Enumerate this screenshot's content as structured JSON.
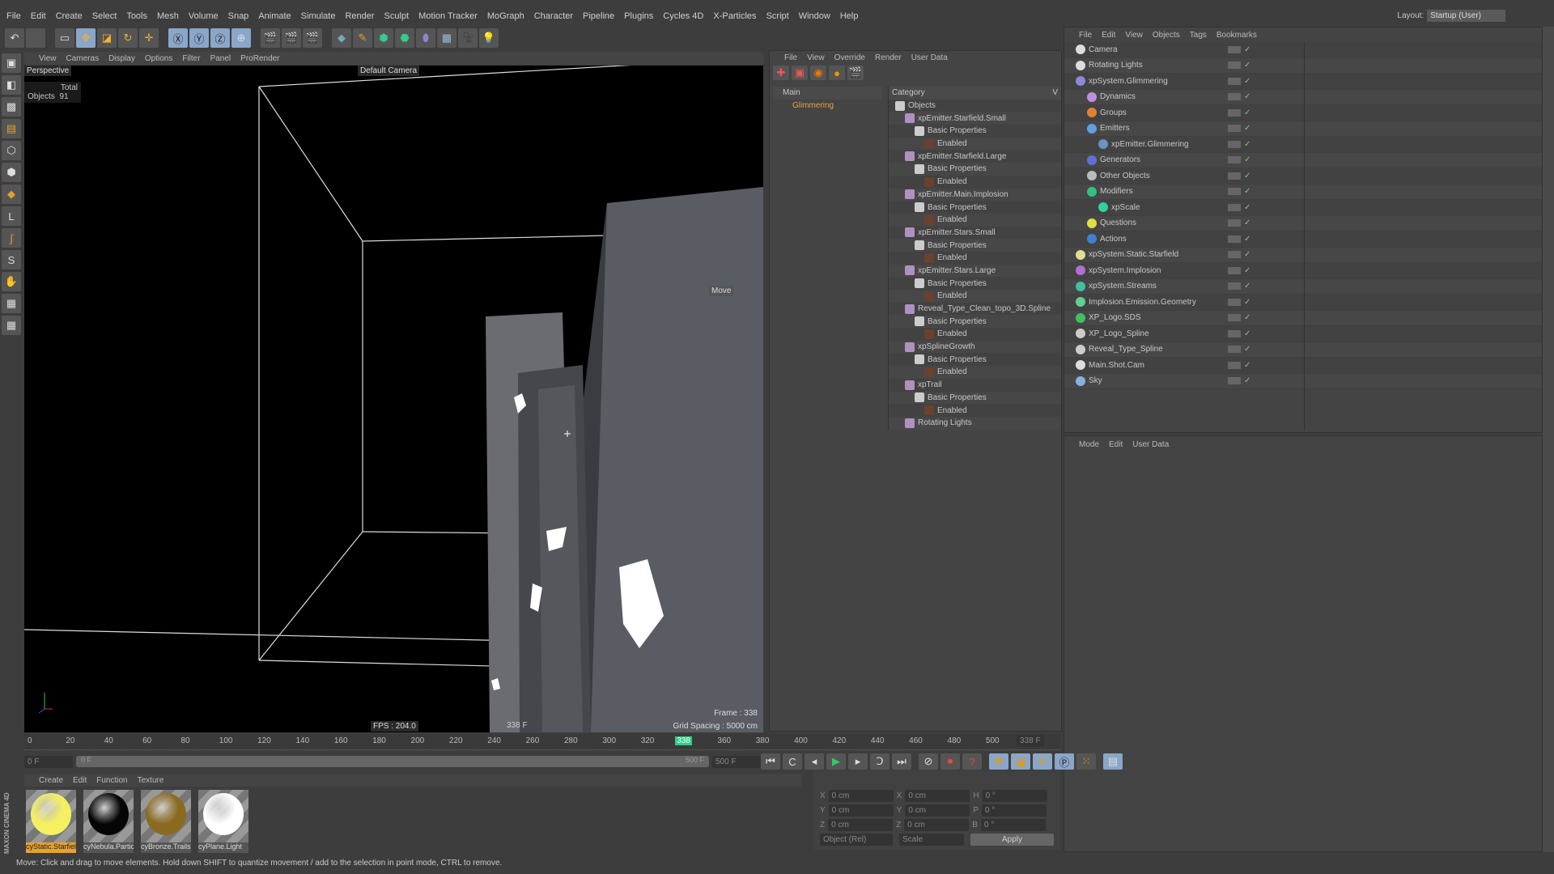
{
  "menu": [
    "File",
    "Edit",
    "Create",
    "Select",
    "Tools",
    "Mesh",
    "Volume",
    "Snap",
    "Animate",
    "Simulate",
    "Render",
    "Sculpt",
    "Motion Tracker",
    "MoGraph",
    "Character",
    "Pipeline",
    "Plugins",
    "Cycles 4D",
    "X-Particles",
    "Script",
    "Window",
    "Help"
  ],
  "layout": {
    "label": "Layout:",
    "value": "Startup (User)"
  },
  "viewport": {
    "menu": [
      "View",
      "Cameras",
      "Display",
      "Options",
      "Filter",
      "Panel",
      "ProRender"
    ],
    "name": "Perspective",
    "camera": "Default Camera",
    "stats_header": "Total",
    "stats_label": "Objects",
    "stats_value": "91",
    "fps": "FPS : 204.0",
    "frame_label": "338 F",
    "frame": "Frame : 338",
    "grid": "Grid Spacing : 5000 cm",
    "hud_move": "Move"
  },
  "takes": {
    "menu": [
      "File",
      "View",
      "Override",
      "Render",
      "User Data"
    ],
    "tree": [
      "Main",
      "Glimmering"
    ],
    "category_header": "Category",
    "value_header": "V",
    "rows": [
      {
        "t": "Objects",
        "l": 0
      },
      {
        "t": "xpEmitter.Starfield.Small",
        "l": 1
      },
      {
        "t": "Basic Properties",
        "l": 2
      },
      {
        "t": "Enabled",
        "l": 3
      },
      {
        "t": "xpEmitter.Starfield.Large",
        "l": 1
      },
      {
        "t": "Basic Properties",
        "l": 2
      },
      {
        "t": "Enabled",
        "l": 3
      },
      {
        "t": "xpEmitter.Main.Implosion",
        "l": 1
      },
      {
        "t": "Basic Properties",
        "l": 2
      },
      {
        "t": "Enabled",
        "l": 3
      },
      {
        "t": "xpEmitter.Stars.Small",
        "l": 1
      },
      {
        "t": "Basic Properties",
        "l": 2
      },
      {
        "t": "Enabled",
        "l": 3
      },
      {
        "t": "xpEmitter.Stars.Large",
        "l": 1
      },
      {
        "t": "Basic Properties",
        "l": 2
      },
      {
        "t": "Enabled",
        "l": 3
      },
      {
        "t": "Reveal_Type_Clean_topo_3D.Spline",
        "l": 1
      },
      {
        "t": "Basic Properties",
        "l": 2
      },
      {
        "t": "Enabled",
        "l": 3
      },
      {
        "t": "xpSplineGrowth",
        "l": 1
      },
      {
        "t": "Basic Properties",
        "l": 2
      },
      {
        "t": "Enabled",
        "l": 3
      },
      {
        "t": "xpTrail",
        "l": 1
      },
      {
        "t": "Basic Properties",
        "l": 2
      },
      {
        "t": "Enabled",
        "l": 3
      },
      {
        "t": "Rotating Lights",
        "l": 1
      }
    ]
  },
  "objects": {
    "menu": [
      "File",
      "Edit",
      "View",
      "Objects",
      "Tags",
      "Bookmarks"
    ],
    "rows": [
      {
        "t": "Camera",
        "l": 0,
        "c": "#ddd"
      },
      {
        "t": "Rotating Lights",
        "l": 0,
        "c": "#ddd"
      },
      {
        "t": "xpSystem.Glimmering",
        "l": 0,
        "c": "#8a8ad8"
      },
      {
        "t": "Dynamics",
        "l": 1,
        "c": "#c090e0"
      },
      {
        "t": "Groups",
        "l": 1,
        "c": "#e08030"
      },
      {
        "t": "Emitters",
        "l": 1,
        "c": "#60a0e0"
      },
      {
        "t": "xpEmitter.Glimmering",
        "l": 2,
        "c": "#7090c0"
      },
      {
        "t": "Generators",
        "l": 1,
        "c": "#6070d0"
      },
      {
        "t": "Other Objects",
        "l": 1,
        "c": "#bbb"
      },
      {
        "t": "Modifiers",
        "l": 1,
        "c": "#30c080"
      },
      {
        "t": "xpScale",
        "l": 2,
        "c": "#30d0a0"
      },
      {
        "t": "Questions",
        "l": 1,
        "c": "#e0e040"
      },
      {
        "t": "Actions",
        "l": 1,
        "c": "#4080d0"
      },
      {
        "t": "xpSystem.Static.Starfield",
        "l": 0,
        "c": "#e0e090"
      },
      {
        "t": "xpSystem.Implosion",
        "l": 0,
        "c": "#b070d0"
      },
      {
        "t": "xpSystem.Streams",
        "l": 0,
        "c": "#40c0a0"
      },
      {
        "t": "Implosion.Emission.Geometry",
        "l": 0,
        "c": "#60d090"
      },
      {
        "t": "XP_Logo.SDS",
        "l": 0,
        "c": "#40c060"
      },
      {
        "t": "XP_Logo_Spline",
        "l": 0,
        "c": "#ccc"
      },
      {
        "t": "Reveal_Type_Spline",
        "l": 0,
        "c": "#ccc"
      },
      {
        "t": "Main.Shot.Cam",
        "l": 0,
        "c": "#ddd"
      },
      {
        "t": "Sky",
        "l": 0,
        "c": "#8ab0e0"
      }
    ]
  },
  "attributes": {
    "menu": [
      "Mode",
      "Edit",
      "User Data"
    ]
  },
  "timeline": {
    "ticks": [
      "0",
      "20",
      "40",
      "60",
      "80",
      "100",
      "120",
      "140",
      "160",
      "180",
      "200",
      "220",
      "240",
      "260",
      "280",
      "300",
      "320",
      "338",
      "360",
      "380",
      "400",
      "420",
      "440",
      "460",
      "480",
      "500"
    ],
    "current": "338 F",
    "start": "0 F",
    "range_start": "0 F",
    "range_end": "500 F",
    "end": "500 F"
  },
  "materials": {
    "menu": [
      "Create",
      "Edit",
      "Function",
      "Texture"
    ],
    "items": [
      {
        "name": "cyStatic.Starfiel",
        "color": "#f4f060"
      },
      {
        "name": "cyNebula.Partic",
        "color": "#050505"
      },
      {
        "name": "cyBronze.Trails",
        "color": "#8a6a20"
      },
      {
        "name": "cyPlane.Light",
        "color": "#ffffff"
      }
    ]
  },
  "coords": {
    "rows": [
      [
        "X",
        "0 cm",
        "X",
        "0 cm",
        "H",
        "0 °"
      ],
      [
        "Y",
        "0 cm",
        "Y",
        "0 cm",
        "P",
        "0 °"
      ],
      [
        "Z",
        "0 cm",
        "Z",
        "0 cm",
        "B",
        "0 °"
      ]
    ],
    "mode": "Object (Rel)",
    "scale": "Scale",
    "apply": "Apply"
  },
  "status": "Move: Click and drag to move elements. Hold down SHIFT to quantize movement / add to the selection in point mode, CTRL to remove.",
  "brand": "MAXON CINEMA 4D"
}
